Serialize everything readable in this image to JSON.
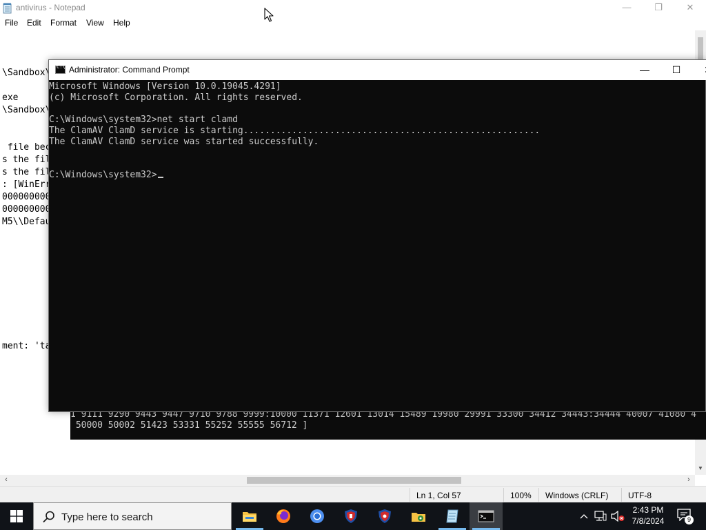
{
  "notepad": {
    "title": "antivirus - Notepad",
    "controls": {
      "minimize": "—",
      "maximize": "❐",
      "close": "✕"
    },
    "menu": [
      "File",
      "Edit",
      "Format",
      "View",
      "Help"
    ],
    "lines": [
      "\\Sandbox\\",
      "exe",
      "\\Sandbox\\",
      " file bec",
      "s the fil",
      "s the fil",
      ": [WinErr",
      "000000000",
      "000000000",
      "M5\\\\Defau",
      "ment: 'ta"
    ],
    "status": {
      "position": "Ln 1, Col 57",
      "zoom": "100%",
      "line_ending": "Windows (CRLF)",
      "encoding": "UTF-8"
    }
  },
  "background_console": {
    "lines": [
      "1 9111 9290 9443 9447 9710 9788 9999:10000 11371 12601 13014 15489 19980 29991 33300 34412 34443:34444 40007 41080 4",
      " 50000 50002 51423 53331 55252 55555 56712 ]"
    ]
  },
  "cmd": {
    "icon_label": "C:\\",
    "title": "Administrator: Command Prompt",
    "controls": {
      "minimize": "—",
      "maximize": "☐",
      "close": "✕"
    },
    "lines": [
      "Microsoft Windows [Version 10.0.19045.4291]",
      "(c) Microsoft Corporation. All rights reserved.",
      "",
      "C:\\Windows\\system32>net start clamd",
      "The ClamAV ClamD service is starting.......................................................",
      "The ClamAV ClamD service was started successfully.",
      "",
      "",
      "C:\\Windows\\system32>"
    ]
  },
  "taskbar": {
    "search_placeholder": "Type here to search",
    "apps": [
      "file-explorer",
      "firefox",
      "chromium",
      "antivirus-shield",
      "antivirus-shield-2",
      "folder-tool",
      "notepad",
      "command-prompt"
    ],
    "clock": {
      "time": "2:43 PM",
      "date": "7/8/2024"
    },
    "notifications_count": "9"
  }
}
